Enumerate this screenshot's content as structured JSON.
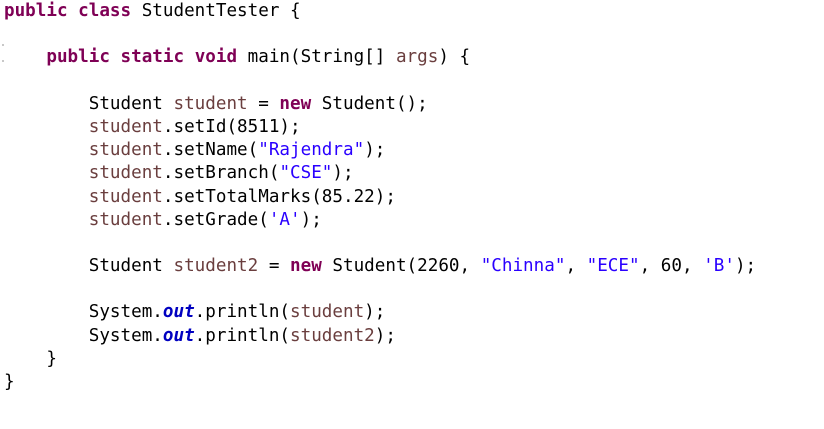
{
  "colors": {
    "background": "#ffffff",
    "keyword": "#7f0055",
    "local_variable": "#6a3e3e",
    "string_literal": "#2a00ff",
    "static_field": "#0000c0",
    "default_text": "#000000"
  },
  "code_lines": [
    [
      {
        "text": "public",
        "style": "keyword"
      },
      {
        "text": " ",
        "style": "plain"
      },
      {
        "text": "class",
        "style": "keyword"
      },
      {
        "text": " StudentTester {",
        "style": "plain"
      }
    ],
    [],
    [
      {
        "text": "    ",
        "style": "plain"
      },
      {
        "text": "public",
        "style": "keyword"
      },
      {
        "text": " ",
        "style": "plain"
      },
      {
        "text": "static",
        "style": "keyword"
      },
      {
        "text": " ",
        "style": "plain"
      },
      {
        "text": "void",
        "style": "keyword"
      },
      {
        "text": " main(String[] ",
        "style": "plain"
      },
      {
        "text": "args",
        "style": "local_variable"
      },
      {
        "text": ") {",
        "style": "plain"
      }
    ],
    [],
    [
      {
        "text": "        Student ",
        "style": "plain"
      },
      {
        "text": "student",
        "style": "local_variable"
      },
      {
        "text": " = ",
        "style": "plain"
      },
      {
        "text": "new",
        "style": "keyword"
      },
      {
        "text": " Student();",
        "style": "plain"
      }
    ],
    [
      {
        "text": "        ",
        "style": "plain"
      },
      {
        "text": "student",
        "style": "local_variable"
      },
      {
        "text": ".setId(8511);",
        "style": "plain"
      }
    ],
    [
      {
        "text": "        ",
        "style": "plain"
      },
      {
        "text": "student",
        "style": "local_variable"
      },
      {
        "text": ".setName(",
        "style": "plain"
      },
      {
        "text": "\"Rajendra\"",
        "style": "string_literal"
      },
      {
        "text": ");",
        "style": "plain"
      }
    ],
    [
      {
        "text": "        ",
        "style": "plain"
      },
      {
        "text": "student",
        "style": "local_variable"
      },
      {
        "text": ".setBranch(",
        "style": "plain"
      },
      {
        "text": "\"CSE\"",
        "style": "string_literal"
      },
      {
        "text": ");",
        "style": "plain"
      }
    ],
    [
      {
        "text": "        ",
        "style": "plain"
      },
      {
        "text": "student",
        "style": "local_variable"
      },
      {
        "text": ".setTotalMarks(85.22);",
        "style": "plain"
      }
    ],
    [
      {
        "text": "        ",
        "style": "plain"
      },
      {
        "text": "student",
        "style": "local_variable"
      },
      {
        "text": ".setGrade(",
        "style": "plain"
      },
      {
        "text": "'A'",
        "style": "string_literal"
      },
      {
        "text": ");",
        "style": "plain"
      }
    ],
    [],
    [
      {
        "text": "        Student ",
        "style": "plain"
      },
      {
        "text": "student2",
        "style": "local_variable"
      },
      {
        "text": " = ",
        "style": "plain"
      },
      {
        "text": "new",
        "style": "keyword"
      },
      {
        "text": " Student(2260, ",
        "style": "plain"
      },
      {
        "text": "\"Chinna\"",
        "style": "string_literal"
      },
      {
        "text": ", ",
        "style": "plain"
      },
      {
        "text": "\"ECE\"",
        "style": "string_literal"
      },
      {
        "text": ", 60, ",
        "style": "plain"
      },
      {
        "text": "'B'",
        "style": "string_literal"
      },
      {
        "text": ");",
        "style": "plain"
      }
    ],
    [],
    [
      {
        "text": "        System.",
        "style": "plain"
      },
      {
        "text": "out",
        "style": "static_field"
      },
      {
        "text": ".println(",
        "style": "plain"
      },
      {
        "text": "student",
        "style": "local_variable"
      },
      {
        "text": ");",
        "style": "plain"
      }
    ],
    [
      {
        "text": "        System.",
        "style": "plain"
      },
      {
        "text": "out",
        "style": "static_field"
      },
      {
        "text": ".println(",
        "style": "plain"
      },
      {
        "text": "student2",
        "style": "local_variable"
      },
      {
        "text": ");",
        "style": "plain"
      }
    ],
    [
      {
        "text": "    }",
        "style": "plain"
      }
    ],
    [
      {
        "text": "}",
        "style": "plain"
      }
    ]
  ]
}
